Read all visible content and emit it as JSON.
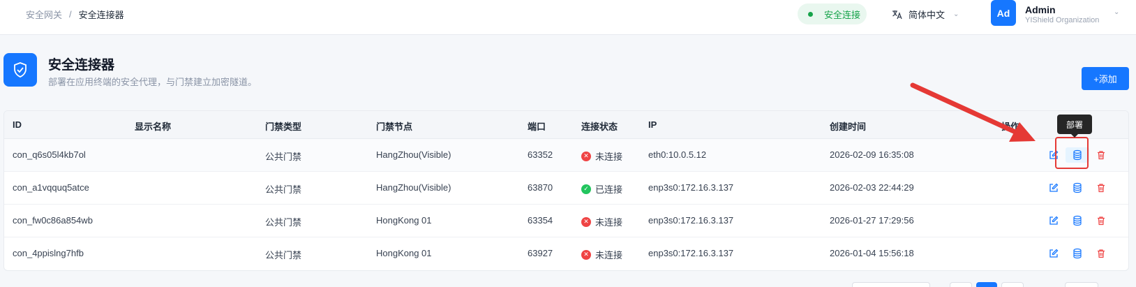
{
  "breadcrumb": {
    "parent": "安全网关",
    "separator": "/",
    "current": "安全连接器"
  },
  "header": {
    "status_badge": "安全连接",
    "language": "简体中文",
    "avatar_initials": "Ad",
    "user_name": "Admin",
    "org": "YIShield Organization"
  },
  "page": {
    "title": "安全连接器",
    "subtitle": "部署在应用终端的安全代理，与门禁建立加密隧道。",
    "add_button": "+添加"
  },
  "table": {
    "columns": [
      "ID",
      "显示名称",
      "门禁类型",
      "门禁节点",
      "端口",
      "连接状态",
      "IP",
      "创建时间",
      "操作"
    ],
    "rows": [
      {
        "id": "con_q6s05l4kb7ol",
        "name": "",
        "type": "公共门禁",
        "node": "HangZhou(Visible)",
        "port": "63352",
        "status": "未连接",
        "online": false,
        "ip": "eth0:10.0.5.12",
        "created": "2026-02-09 16:35:08"
      },
      {
        "id": "con_a1vqquq5atce",
        "name": "",
        "type": "公共门禁",
        "node": "HangZhou(Visible)",
        "port": "63870",
        "status": "已连接",
        "online": true,
        "ip": "enp3s0:172.16.3.137",
        "created": "2026-02-03 22:44:29"
      },
      {
        "id": "con_fw0c86a854wb",
        "name": "",
        "type": "公共门禁",
        "node": "HongKong 01",
        "port": "63354",
        "status": "未连接",
        "online": false,
        "ip": "enp3s0:172.16.3.137",
        "created": "2026-01-27 17:29:56"
      },
      {
        "id": "con_4ppislng7hfb",
        "name": "",
        "type": "公共门禁",
        "node": "HongKong 01",
        "port": "63927",
        "status": "未连接",
        "online": false,
        "ip": "enp3s0:172.16.3.137",
        "created": "2026-01-04 15:56:18"
      }
    ]
  },
  "tooltip": "部署",
  "colors": {
    "primary": "#1677ff",
    "success": "#22c55e",
    "danger": "#ef4444",
    "annotation": "#e53935"
  },
  "icons": [
    "shield-check-icon",
    "translate-icon",
    "chevron-down-icon",
    "edit-icon",
    "deploy-database-icon",
    "trash-icon"
  ]
}
